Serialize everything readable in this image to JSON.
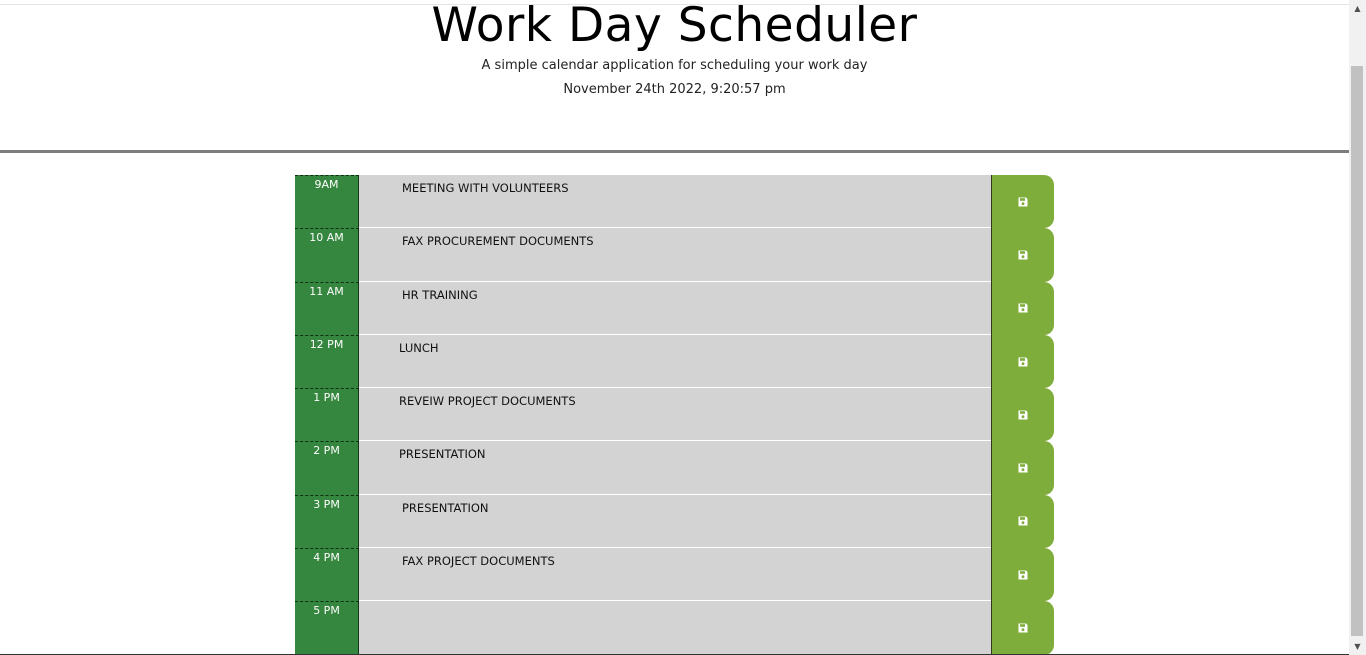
{
  "header": {
    "title": "Work Day Scheduler",
    "subtitle": "A simple calendar application for scheduling your work day",
    "current_datetime": "November 24th 2022, 9:20:57 pm"
  },
  "colors": {
    "hour_bg": "#35863e",
    "row_bg": "#d3d3d3",
    "save_bg": "#7fad3b"
  },
  "time_blocks": [
    {
      "hour": "9AM",
      "text": "MEETING WITH VOLUNTEERS",
      "save_icon": "floppy-disk-icon"
    },
    {
      "hour": "10 AM",
      "text": "FAX PROCUREMENT DOCUMENTS",
      "save_icon": "floppy-disk-icon"
    },
    {
      "hour": "11 AM",
      "text": "HR TRAINING",
      "save_icon": "floppy-disk-icon"
    },
    {
      "hour": "12 PM",
      "text": "LUNCH",
      "save_icon": "floppy-disk-icon"
    },
    {
      "hour": "1 PM",
      "text": "REVEIW PROJECT DOCUMENTS",
      "save_icon": "floppy-disk-icon"
    },
    {
      "hour": "2 PM",
      "text": "PRESENTATION",
      "save_icon": "floppy-disk-icon"
    },
    {
      "hour": "3 PM",
      "text": "PRESENTATION",
      "save_icon": "floppy-disk-icon"
    },
    {
      "hour": "4 PM",
      "text": "FAX PROJECT DOCUMENTS",
      "save_icon": "floppy-disk-icon"
    },
    {
      "hour": "5 PM",
      "text": "",
      "save_icon": "floppy-disk-icon"
    }
  ],
  "scrollbar": {
    "up_icon": "scroll-up-arrow-icon",
    "down_icon": "scroll-down-arrow-icon"
  }
}
